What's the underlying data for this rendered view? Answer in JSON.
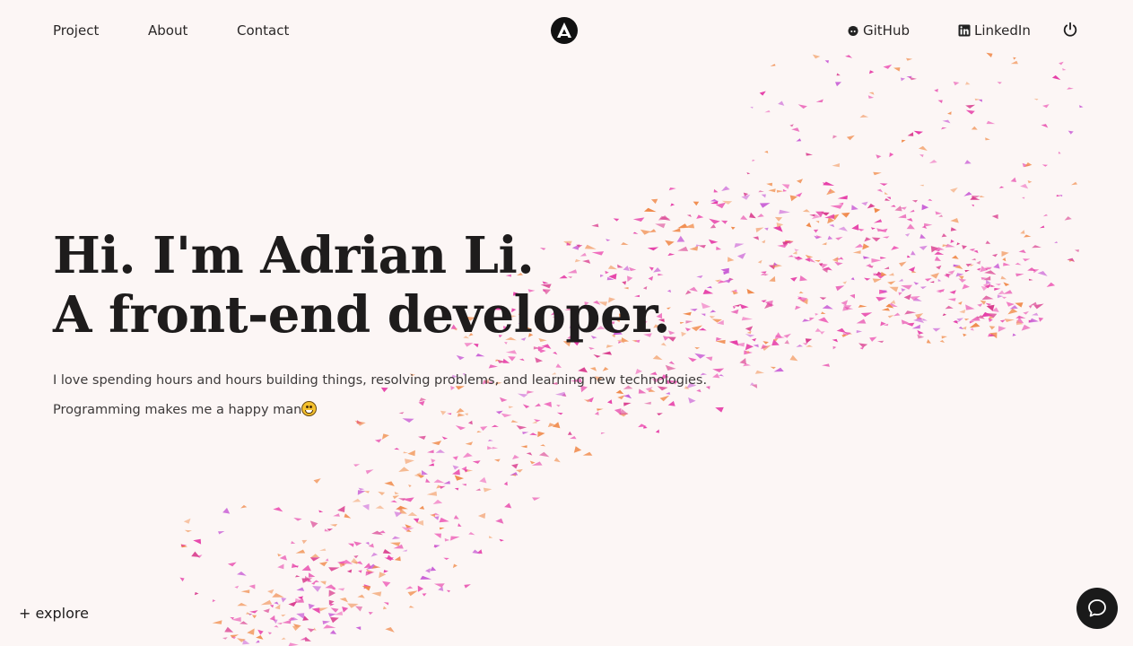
{
  "nav": {
    "project": "Project",
    "about": "About",
    "contact": "Contact"
  },
  "social": {
    "github": "GitHub",
    "linkedin": "LinkedIn"
  },
  "hero": {
    "line1": "Hi. I'm Adrian Li.",
    "line2": "A front-end developer.",
    "desc1": "I love spending hours and hours building things, resolving problems, and learning new technologies.",
    "desc2": "Programming makes me a happy man"
  },
  "explore": "+ explore",
  "colors": {
    "background": "#fcf6f5",
    "particle_pink": "#e63fa8",
    "particle_orange": "#f08a4b",
    "text": "#1e1c1c"
  },
  "icons": {
    "logo": "letter-a-logo",
    "github": "github-icon",
    "linkedin": "linkedin-icon",
    "power": "power-icon",
    "chat": "chat-bubble-icon",
    "emoji": "grinning-face-emoji"
  }
}
